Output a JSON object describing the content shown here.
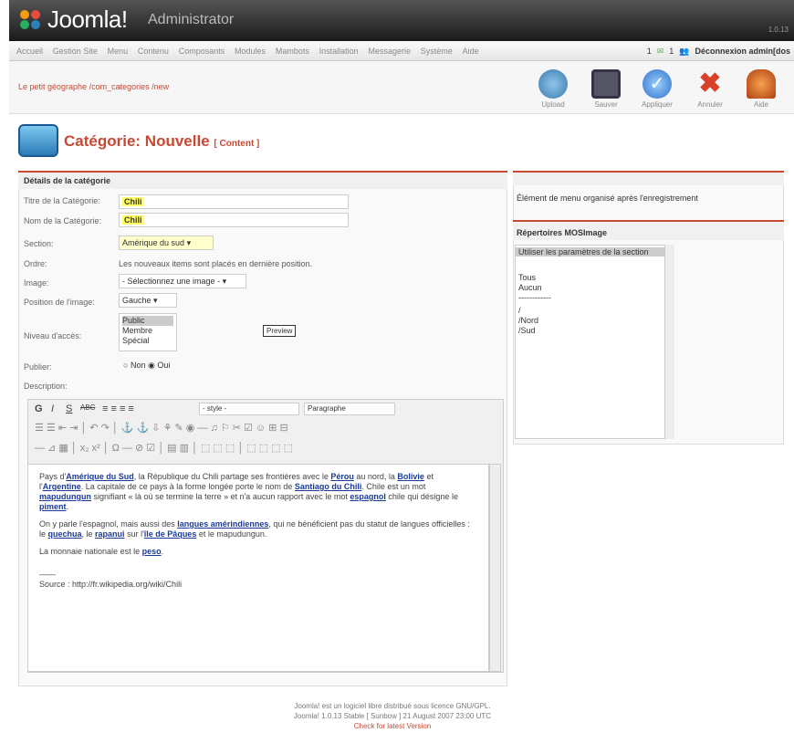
{
  "header": {
    "logo_text": "Joomla!",
    "admin_text": "Administrator",
    "version": "1.0.13"
  },
  "menu": [
    "Accueil",
    "Gestion Site",
    "Menu",
    "Contenu",
    "Composants",
    "Modules",
    "Mambots",
    "Installation",
    "Messagerie",
    "Système",
    "Aide"
  ],
  "menu_right": {
    "count1": "1",
    "count2": "1",
    "logout": "Déconnexion admin[dos"
  },
  "breadcrumb": "Le petit géographe /com_categories /new",
  "toolbar": [
    {
      "label": "Upload",
      "icon": "upload-icon",
      "color": "#4a90c0"
    },
    {
      "label": "Sauver",
      "icon": "save-icon",
      "color": "#556"
    },
    {
      "label": "Appliquer",
      "icon": "apply-icon",
      "color": "#3a7fd4"
    },
    {
      "label": "Annuler",
      "icon": "cancel-icon",
      "color": "#d9402a"
    },
    {
      "label": "Aide",
      "icon": "help-icon",
      "color": "#c85020"
    }
  ],
  "page": {
    "title": "Catégorie: Nouvelle",
    "subtitle": "[ Content ]"
  },
  "form": {
    "section_title": "Détails de la catégorie",
    "title_label": "Titre de la Catégorie:",
    "title_value": "Chili",
    "name_label": "Nom de la Catégorie:",
    "name_value": "Chili",
    "section_label": "Section:",
    "section_value": "Amérique du sud",
    "order_label": "Ordre:",
    "order_value": "Les nouveaux items sont placés en dernière position.",
    "image_label": "Image:",
    "image_value": "- Sélectionnez une image -",
    "imagepos_label": "Position de l'image:",
    "imagepos_value": "Gauche",
    "access_label": "Niveau d'accès:",
    "access_options": [
      "Public",
      "Membre",
      "Spécial"
    ],
    "preview_label": "Preview",
    "publish_label": "Publier:",
    "publish_no": "Non",
    "publish_yes": "Oui",
    "desc_label": "Description:"
  },
  "editor": {
    "style_select": "- style -",
    "format_select": "Paragraphe",
    "p1_a": "Pays d'",
    "l1": "Amérique du Sud",
    "p1_b": ", la République du Chili partage ses frontières avec le ",
    "l2": "Pérou",
    "p1_c": " au nord, la ",
    "l3": "Bolivie",
    "p1_d": " et l'",
    "l4": "Argentine",
    "p1_e": ". La capitale de ce pays à la forme longée porte le nom de ",
    "l5": "Santiago du Chili",
    "p1_f": ". Chile est un mot ",
    "l6": "mapudungun",
    "p1_g": " signifiant « là où se termine la terre » et n'a aucun rapport avec le mot ",
    "l7": "espagnol",
    "p1_h": " chile qui désigne le ",
    "l8": "piment",
    "p1_i": ".",
    "p2_a": "On y parle l'espagnol, mais aussi des ",
    "l9": "langues amérindiennes",
    "p2_b": ", qui ne bénéficient pas du statut de langues officielles : le ",
    "l10": "quechua",
    "p2_c": ", le ",
    "l11": "rapanui",
    "p2_d": " sur l'",
    "l12": "île de Pâques",
    "p2_e": " et le mapudungun.",
    "p3_a": "La monnaie nationale est le ",
    "l13": "peso",
    "p3_b": ".",
    "p4": "Source : http://fr.wikipedia.org/wiki/Chili"
  },
  "side": {
    "info": "Élément de menu organisé après l'enregistrement",
    "heading": "Répertoires MOSImage",
    "options": [
      "Utiliser les paramètres de la section",
      "Tous",
      "Aucun",
      "------------",
      "/",
      "/Nord",
      "/Sud"
    ]
  },
  "footer": {
    "line1": "Joomla! est un logiciel libre distribué sous licence GNU/GPL.",
    "line2": "Joomla! 1.0.13 Stable [ Sunbow ] 21 August 2007 23:00 UTC",
    "line3": "Check for latest Version"
  }
}
